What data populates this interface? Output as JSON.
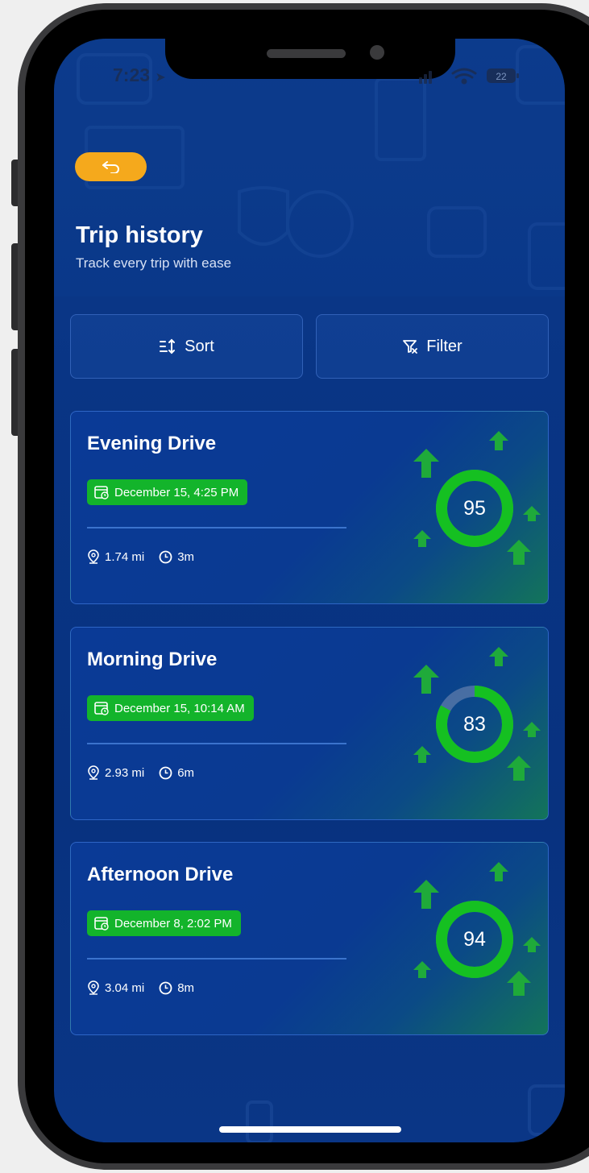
{
  "status_bar": {
    "time": "7:23",
    "battery": "22"
  },
  "header": {
    "back_icon": "back-arrow-icon",
    "title": "Trip history",
    "subtitle": "Track every trip with ease"
  },
  "controls": {
    "sort_label": "Sort",
    "sort_icon": "sort-icon",
    "filter_label": "Filter",
    "filter_icon": "filter-icon"
  },
  "trips": [
    {
      "title": "Evening Drive",
      "date": "December 15, 4:25 PM",
      "distance": "1.74 mi",
      "duration": "3m",
      "score": "95",
      "score_fraction": 1.0
    },
    {
      "title": "Morning Drive",
      "date": "December 15, 10:14 AM",
      "distance": "2.93 mi",
      "duration": "6m",
      "score": "83",
      "score_fraction": 0.83
    },
    {
      "title": "Afternoon Drive",
      "date": "December 8, 2:02 PM",
      "distance": "3.04 mi",
      "duration": "8m",
      "score": "94",
      "score_fraction": 1.0
    }
  ],
  "colors": {
    "accent": "#f5a91c",
    "badge_green": "#13b42b",
    "score_ring": "#15c021",
    "background": "#0a3686"
  }
}
